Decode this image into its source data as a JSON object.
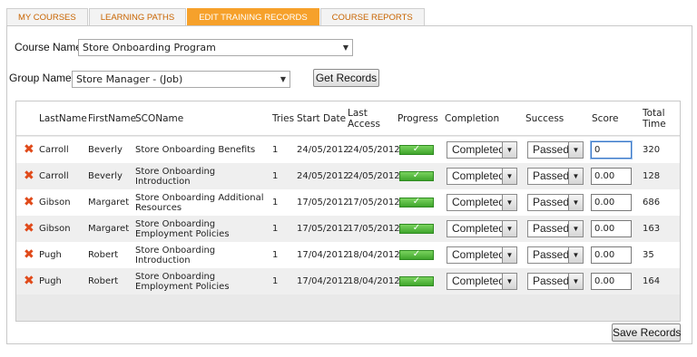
{
  "tabs": [
    {
      "label": "MY COURSES"
    },
    {
      "label": "LEARNING PATHS"
    },
    {
      "label": "EDIT TRAINING RECORDS"
    },
    {
      "label": "COURSE REPORTS"
    }
  ],
  "form": {
    "course_label": "Course Name:",
    "course_value": "Store Onboarding Program",
    "group_label": "Group Name:",
    "group_value": "Store Manager - (Job)",
    "get_records": "Get Records"
  },
  "columns": {
    "last": "LastName",
    "first": "FirstName",
    "sco": "SCOName",
    "tries": "Tries",
    "start": "Start Date",
    "last_access_1": "Last",
    "last_access_2": "Access",
    "progress": "Progress",
    "completion": "Completion",
    "success": "Success",
    "score": "Score",
    "total_1": "Total",
    "total_2": "Time"
  },
  "rows": [
    {
      "last": "Carroll",
      "first": "Beverly",
      "sco": "Store Onboarding Benefits",
      "tries": "1",
      "start": "24/05/2012",
      "access": "24/05/2012",
      "progress": "✓",
      "completion": "Completed",
      "success": "Passed",
      "score": "0",
      "time": "320"
    },
    {
      "last": "Carroll",
      "first": "Beverly",
      "sco": "Store Onboarding Introduction",
      "tries": "1",
      "start": "24/05/2012",
      "access": "24/05/2012",
      "progress": "✓",
      "completion": "Completed",
      "success": "Passed",
      "score": "0.00",
      "time": "128"
    },
    {
      "last": "Gibson",
      "first": "Margaret",
      "sco": "Store Onboarding Additional Resources",
      "tries": "1",
      "start": "17/05/2012",
      "access": "17/05/2012",
      "progress": "✓",
      "completion": "Completed",
      "success": "Passed",
      "score": "0.00",
      "time": "686"
    },
    {
      "last": "Gibson",
      "first": "Margaret",
      "sco": "Store Onboarding Employment Policies",
      "tries": "1",
      "start": "17/05/2012",
      "access": "17/05/2012",
      "progress": "✓",
      "completion": "Completed",
      "success": "Passed",
      "score": "0.00",
      "time": "163"
    },
    {
      "last": "Pugh",
      "first": "Robert",
      "sco": "Store Onboarding Introduction",
      "tries": "1",
      "start": "17/04/2012",
      "access": "18/04/2012",
      "progress": "✓",
      "completion": "Completed",
      "success": "Passed",
      "score": "0.00",
      "time": "35"
    },
    {
      "last": "Pugh",
      "first": "Robert",
      "sco": "Store Onboarding Employment Policies",
      "tries": "1",
      "start": "17/04/2012",
      "access": "18/04/2012",
      "progress": "✓",
      "completion": "Completed",
      "success": "Passed",
      "score": "0.00",
      "time": "164"
    }
  ],
  "save_records": "Save Records",
  "icons": {
    "delete": "close-icon",
    "dropdown": "chevron-down-icon"
  },
  "colors": {
    "active_tab": "#f6a12b",
    "tab_text": "#c86400",
    "delete": "#e04a1a",
    "progress": "#3fa52c"
  }
}
